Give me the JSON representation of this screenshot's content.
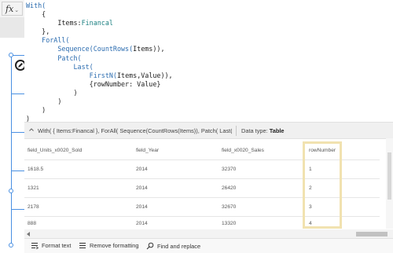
{
  "formula_bar": {
    "fx_label": "fx",
    "chevron": "⌄",
    "code_lines": [
      [
        {
          "t": "With(",
          "c": "kw"
        }
      ],
      [
        {
          "t": "    {",
          "c": "pn"
        }
      ],
      [
        {
          "t": "        Items:",
          "c": "pn"
        },
        {
          "t": "Financal",
          "c": "id"
        }
      ],
      [
        {
          "t": "    },",
          "c": "pn"
        }
      ],
      [
        {
          "t": "    ForAll(",
          "c": "fn"
        }
      ],
      [
        {
          "t": "        Sequence(",
          "c": "fn"
        },
        {
          "t": "CountRows(",
          "c": "fn"
        },
        {
          "t": "Items",
          "c": "pn"
        },
        {
          "t": ")),",
          "c": "pn"
        }
      ],
      [
        {
          "t": "        Patch(",
          "c": "fn"
        }
      ],
      [
        {
          "t": "            Last(",
          "c": "fn"
        }
      ],
      [
        {
          "t": "                FirstN(",
          "c": "fn"
        },
        {
          "t": "Items,Value",
          "c": "pn"
        },
        {
          "t": ")),",
          "c": "pn"
        }
      ],
      [
        {
          "t": "                {rowNumber: Value}",
          "c": "pn"
        }
      ],
      [
        {
          "t": "            )",
          "c": "pn"
        }
      ],
      [
        {
          "t": "        )",
          "c": "pn"
        }
      ],
      [
        {
          "t": "    )",
          "c": "pn"
        }
      ],
      [
        {
          "t": ")",
          "c": "pn"
        }
      ]
    ]
  },
  "results": {
    "summary": "With( { Items:Financal }, ForAll( Sequence(CountRows(Items)), Patch( Last( Firs...",
    "data_type_label": "Data type:",
    "data_type_value": "Table",
    "columns": [
      "field_Units_x0020_Sold",
      "field_Year",
      "field_x0020_Sales",
      "rowNumber"
    ],
    "rows": [
      [
        "1618.5",
        "2014",
        "32370",
        "1"
      ],
      [
        "1321",
        "2014",
        "26420",
        "2"
      ],
      [
        "2178",
        "2014",
        "32670",
        "3"
      ],
      [
        "888",
        "2014",
        "13320",
        "4"
      ]
    ]
  },
  "toolbar": {
    "format_text": "Format text",
    "remove_formatting": "Remove formatting",
    "find_replace": "Find and replace"
  },
  "colors": {
    "highlight_border": "#f1e2b0",
    "selection_blue": "#4a90e2",
    "keyword_blue": "#2b6cb0",
    "identifier_teal": "#1a7f80"
  },
  "icons": [
    "formula-fx-icon",
    "control-edit-icon",
    "collapse-chevron-icon",
    "format-text-icon",
    "remove-formatting-icon",
    "find-replace-icon"
  ]
}
